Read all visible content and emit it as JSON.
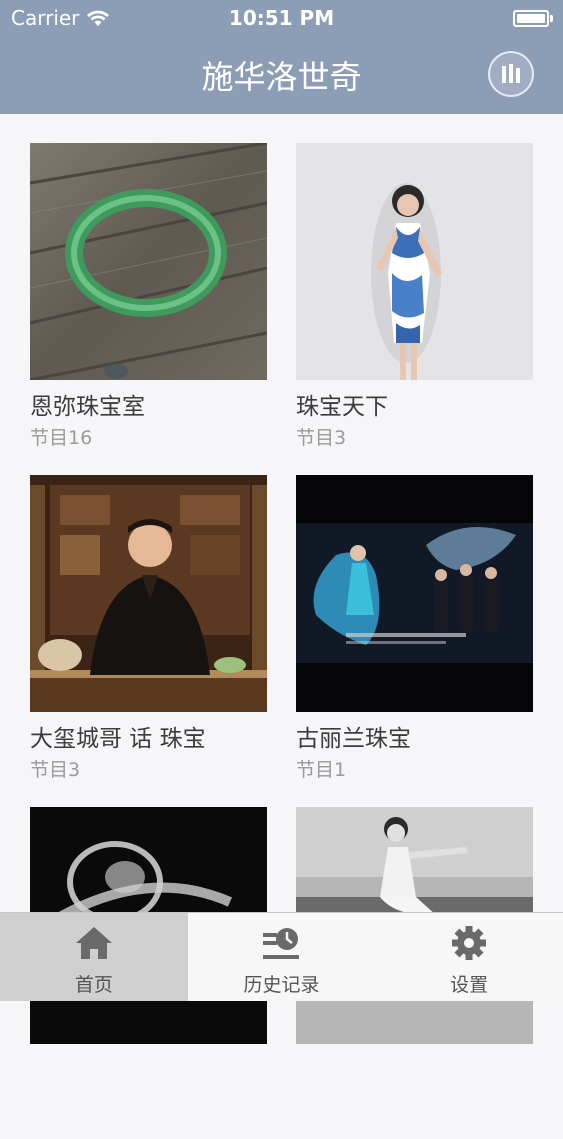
{
  "status_bar": {
    "carrier": "Carrier",
    "time": "10:51 PM"
  },
  "nav": {
    "title": "施华洛世奇",
    "action_icon": "equalizer-icon"
  },
  "programs": [
    {
      "title": "恩弥珠宝室",
      "subtitle": "节目16",
      "image": "jade-bangle-photo"
    },
    {
      "title": "珠宝天下",
      "subtitle": "节目3",
      "image": "qipao-model-photo"
    },
    {
      "title": "大玺城哥 话 珠宝",
      "subtitle": "节目3",
      "image": "host-studio-photo"
    },
    {
      "title": "古丽兰珠宝",
      "subtitle": "节目1",
      "image": "fashion-ad-photo"
    },
    {
      "title": "",
      "subtitle": "",
      "image": "crystal-ring-photo"
    },
    {
      "title": "",
      "subtitle": "",
      "image": "vintage-dancer-photo"
    }
  ],
  "tabbar": {
    "tabs": [
      {
        "label": "首页",
        "icon": "home-icon",
        "active": true
      },
      {
        "label": "历史记录",
        "icon": "history-icon",
        "active": false
      },
      {
        "label": "设置",
        "icon": "gear-icon",
        "active": false
      }
    ]
  },
  "colors": {
    "nav_background": "#8c9db6",
    "active_tab": "#d0d0d0",
    "title_text": "#3c3c3c",
    "subtitle_text": "#9a9a9a"
  }
}
